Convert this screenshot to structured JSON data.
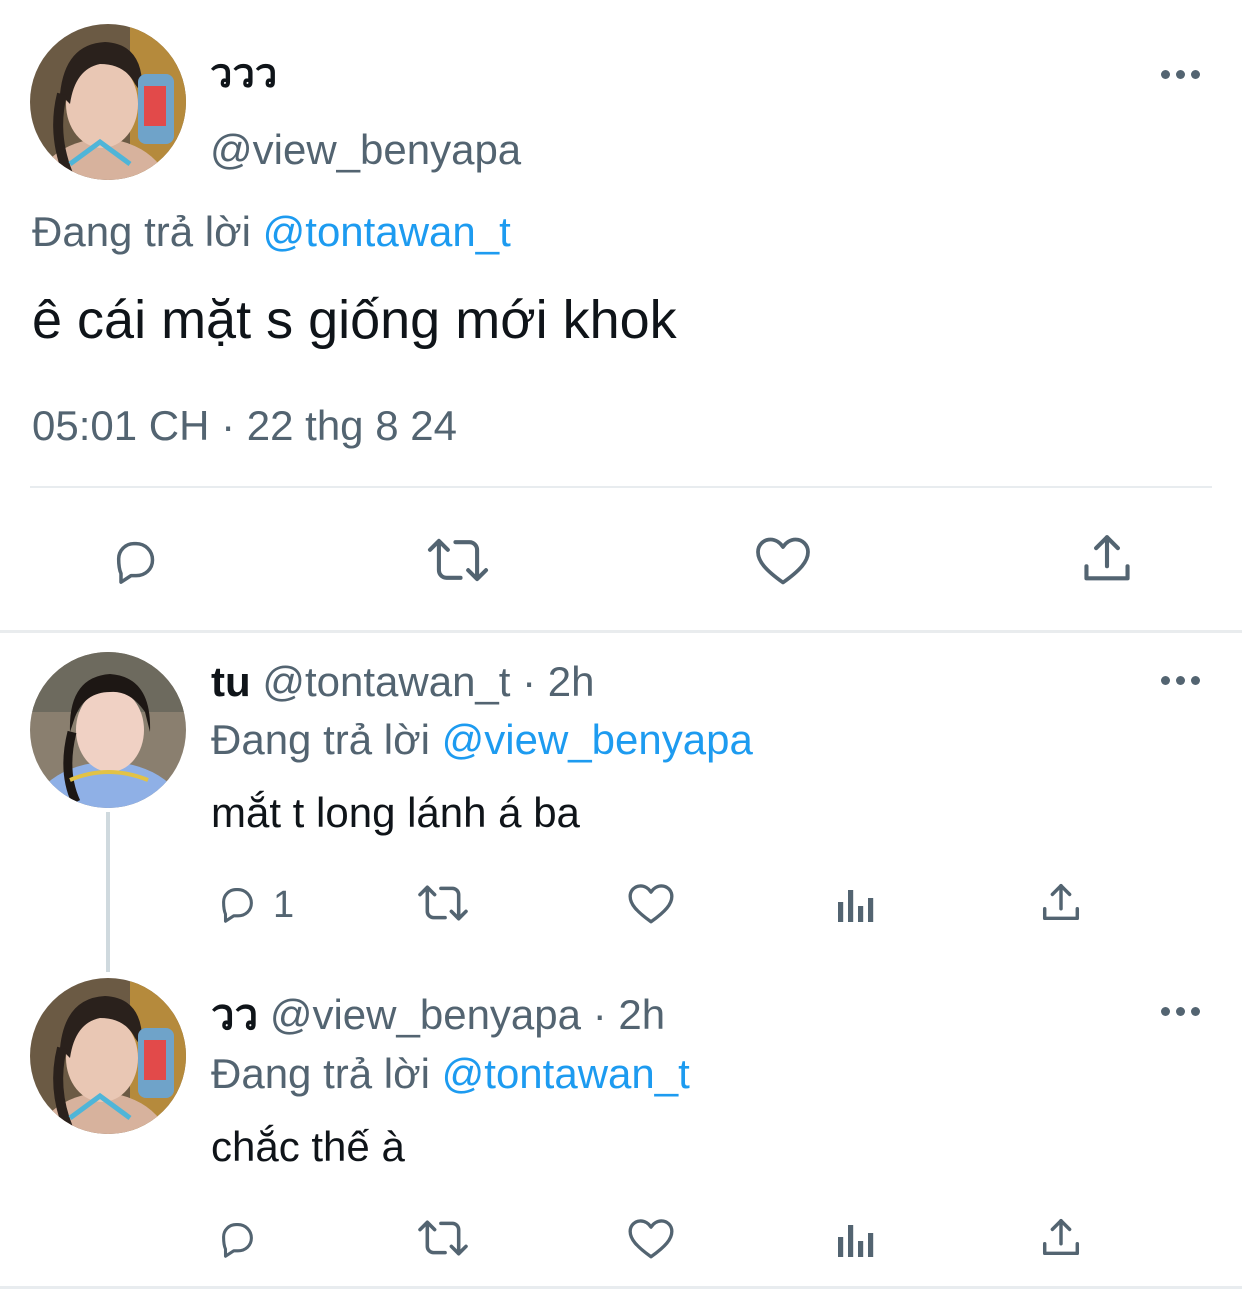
{
  "main_tweet": {
    "display_name": "ววว",
    "handle": "@view_benyapa",
    "replying_prefix": "Đang trả lời",
    "replying_to": "@tontawan_t",
    "text": "ê cái mặt s giống mới khok",
    "timestamp": "05:01 CH · 22 thg 8 24"
  },
  "replies": [
    {
      "display_name": "tu",
      "handle": "@tontawan_t",
      "time": "· 2h",
      "replying_prefix": "Đang trả lời",
      "replying_to": "@view_benyapa",
      "text": "mắt t long lánh á ba",
      "reply_count": "1"
    },
    {
      "display_name": "วว",
      "handle": "@view_benyapa",
      "time": "· 2h",
      "replying_prefix": "Đang trả lời",
      "replying_to": "@tontawan_t",
      "text": "chắc thế à",
      "reply_count": ""
    }
  ],
  "colors": {
    "text": "#0f1419",
    "secondary": "#536471",
    "link": "#1d9bf0",
    "divider": "#e8ecef"
  },
  "icons": [
    "more-icon",
    "reply-icon",
    "retweet-icon",
    "like-icon",
    "share-icon",
    "views-icon"
  ]
}
